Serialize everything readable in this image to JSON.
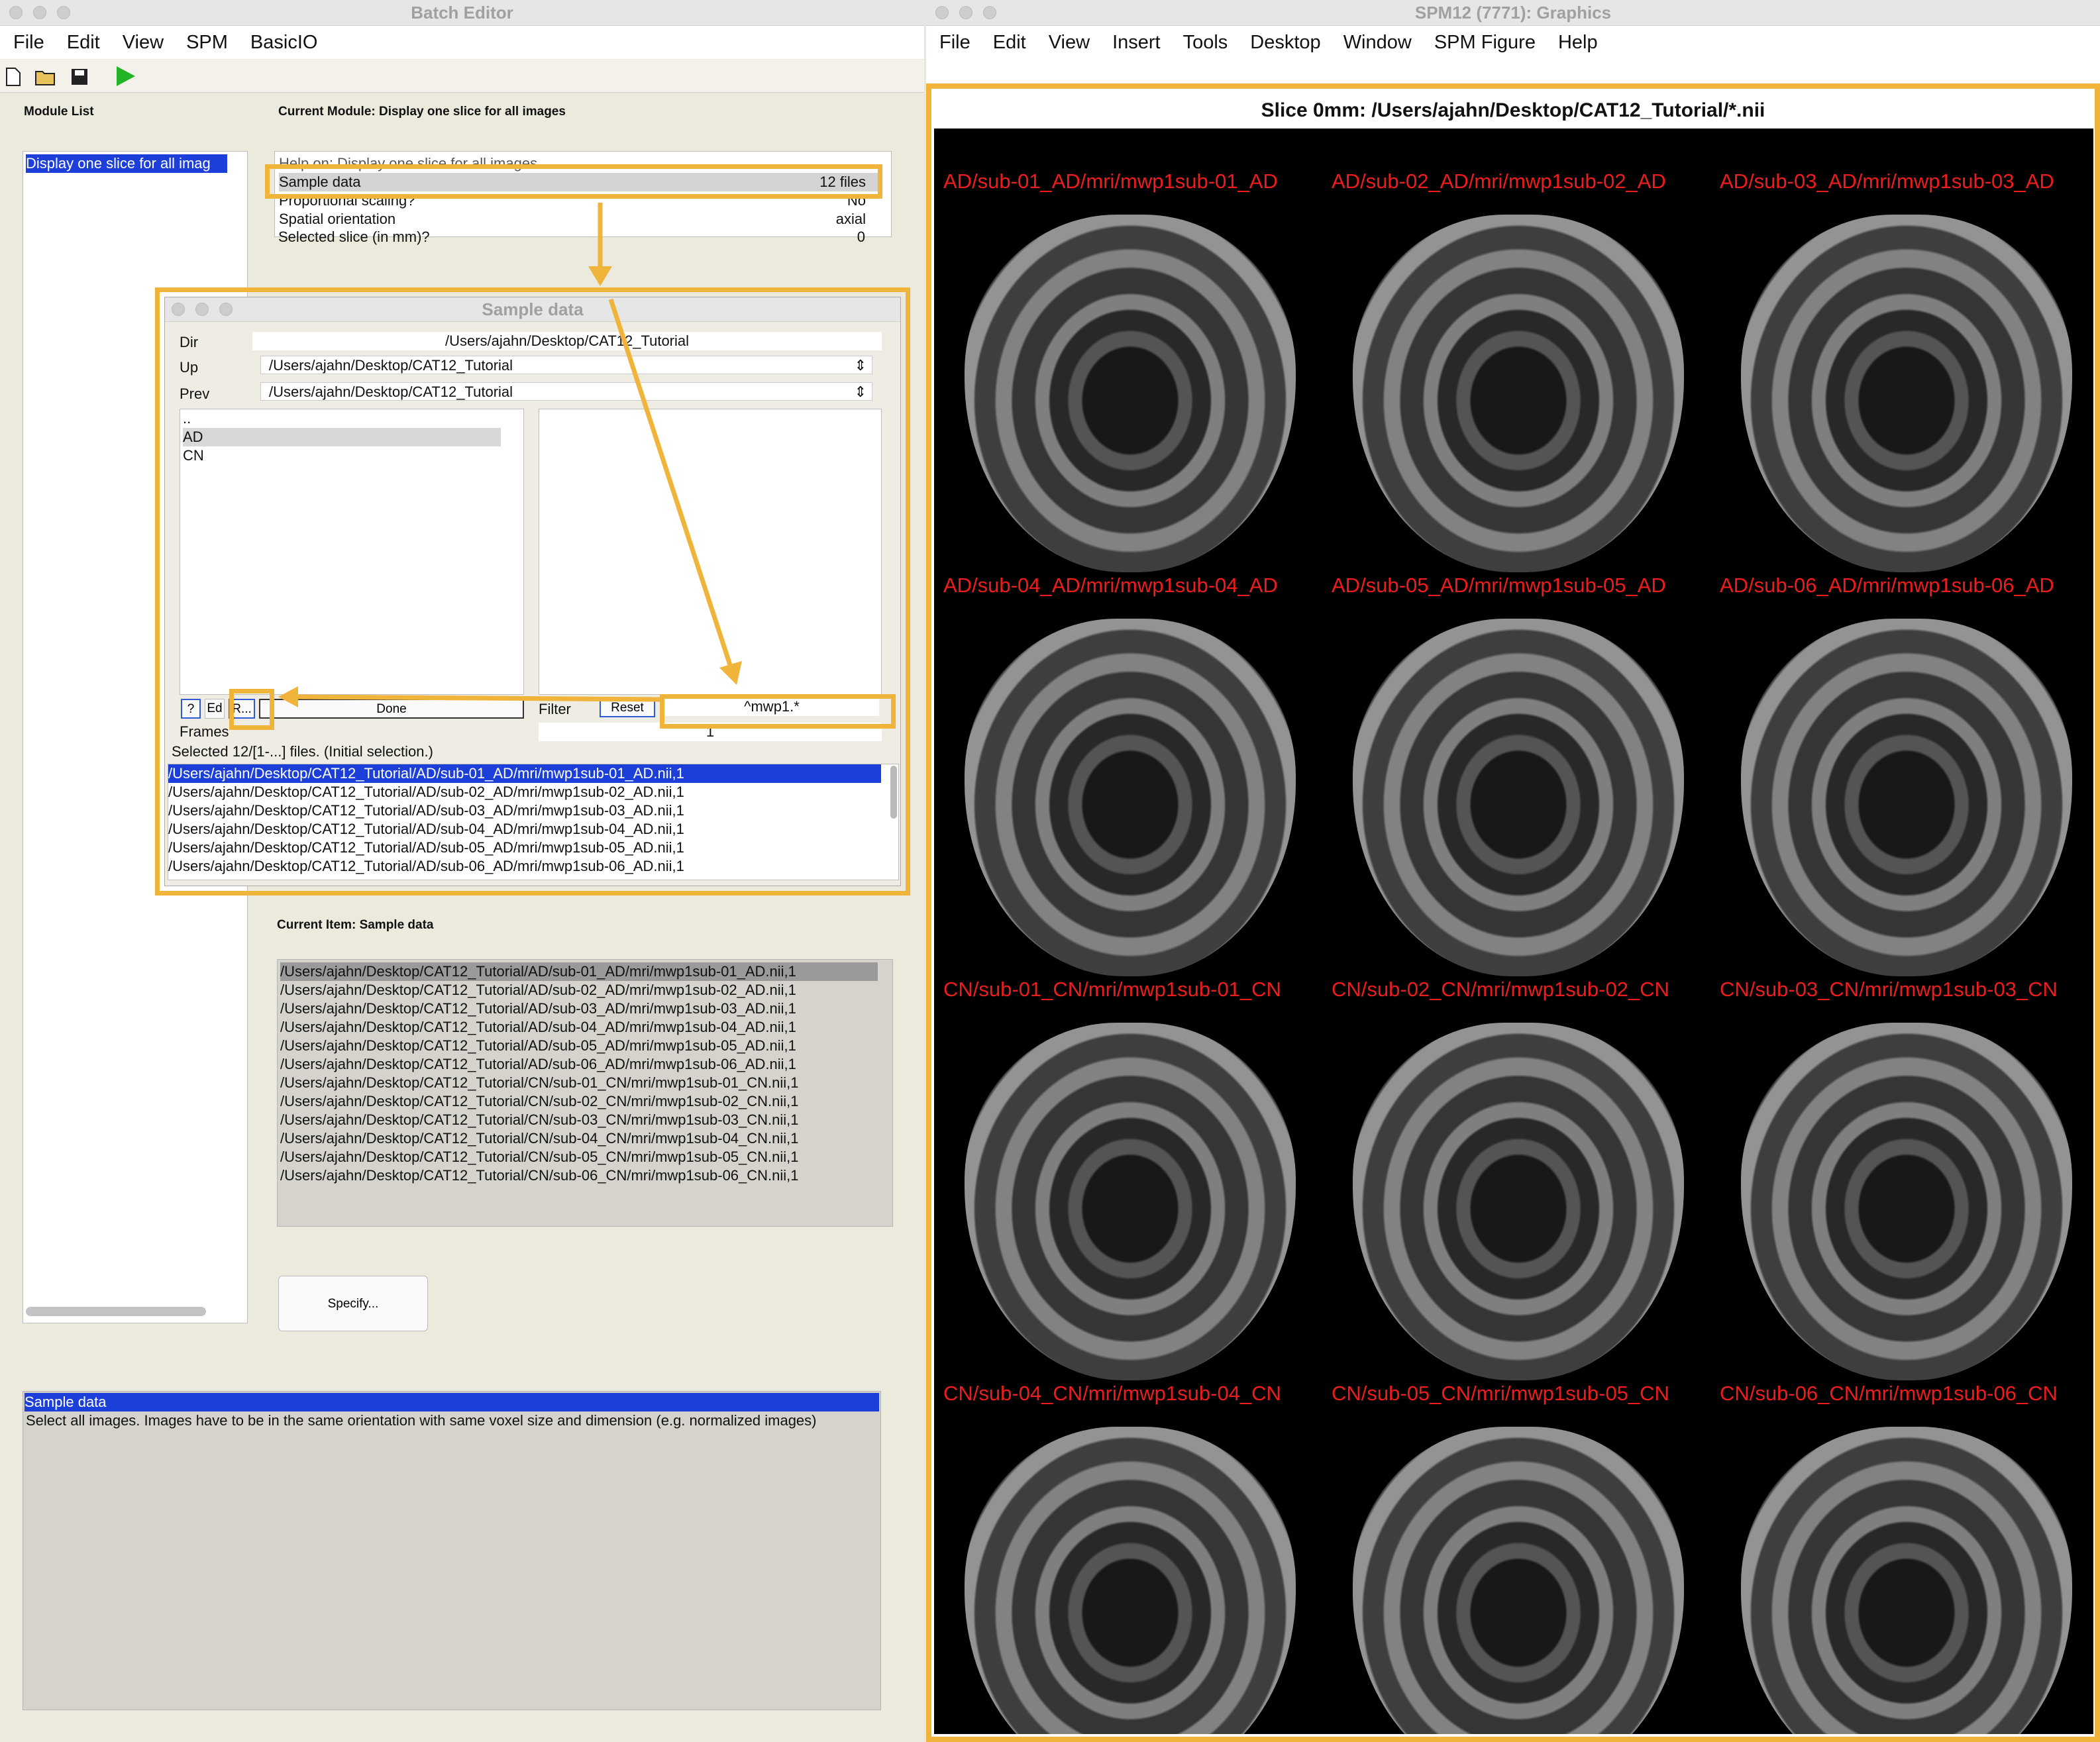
{
  "batch_editor": {
    "title": "Batch Editor",
    "menu": [
      "File",
      "Edit",
      "View",
      "SPM",
      "BasicIO"
    ],
    "module_list_label": "Module List",
    "current_module_label": "Current Module: Display one slice for all images",
    "module_list_items": [
      "Display one slice for all imag"
    ],
    "help_row": "Help on: Display one slice for all images",
    "module_rows": [
      {
        "name": "Sample data",
        "value": "12 files"
      },
      {
        "name": "Proportional scaling?",
        "value": "No"
      },
      {
        "name": "Spatial orientation",
        "value": "axial"
      },
      {
        "name": "Selected slice (in mm)?",
        "value": "0"
      }
    ],
    "current_item_label": "Current Item: Sample data",
    "current_item_files": [
      "/Users/ajahn/Desktop/CAT12_Tutorial/AD/sub-01_AD/mri/mwp1sub-01_AD.nii,1",
      "/Users/ajahn/Desktop/CAT12_Tutorial/AD/sub-02_AD/mri/mwp1sub-02_AD.nii,1",
      "/Users/ajahn/Desktop/CAT12_Tutorial/AD/sub-03_AD/mri/mwp1sub-03_AD.nii,1",
      "/Users/ajahn/Desktop/CAT12_Tutorial/AD/sub-04_AD/mri/mwp1sub-04_AD.nii,1",
      "/Users/ajahn/Desktop/CAT12_Tutorial/AD/sub-05_AD/mri/mwp1sub-05_AD.nii,1",
      "/Users/ajahn/Desktop/CAT12_Tutorial/AD/sub-06_AD/mri/mwp1sub-06_AD.nii,1",
      "/Users/ajahn/Desktop/CAT12_Tutorial/CN/sub-01_CN/mri/mwp1sub-01_CN.nii,1",
      "/Users/ajahn/Desktop/CAT12_Tutorial/CN/sub-02_CN/mri/mwp1sub-02_CN.nii,1",
      "/Users/ajahn/Desktop/CAT12_Tutorial/CN/sub-03_CN/mri/mwp1sub-03_CN.nii,1",
      "/Users/ajahn/Desktop/CAT12_Tutorial/CN/sub-04_CN/mri/mwp1sub-04_CN.nii,1",
      "/Users/ajahn/Desktop/CAT12_Tutorial/CN/sub-05_CN/mri/mwp1sub-05_CN.nii,1",
      "/Users/ajahn/Desktop/CAT12_Tutorial/CN/sub-06_CN/mri/mwp1sub-06_CN.nii,1"
    ],
    "specify_label": "Specify...",
    "help_title": "Sample data",
    "help_text": "Select all images. Images have to be in the same orientation with same voxel size and dimension (e.g. normalized images)"
  },
  "sample_dialog": {
    "title": "Sample data",
    "dir_label": "Dir",
    "dir_value": "/Users/ajahn/Desktop/CAT12_Tutorial",
    "up_label": "Up",
    "up_value": "/Users/ajahn/Desktop/CAT12_Tutorial",
    "prev_label": "Prev",
    "prev_value": "/Users/ajahn/Desktop/CAT12_Tutorial",
    "dirs": [
      "..",
      "AD",
      "CN"
    ],
    "btn_help": "?",
    "btn_ed": "Ed",
    "btn_r": "R...",
    "btn_done": "Done",
    "filter_label": "Filter",
    "btn_reset": "Reset",
    "filter_value": "^mwp1.*",
    "frames_label": "Frames",
    "frames_value": "1",
    "selected_text": "Selected 12/[1-...] files. (Initial selection.)",
    "selected_files": [
      "/Users/ajahn/Desktop/CAT12_Tutorial/AD/sub-01_AD/mri/mwp1sub-01_AD.nii,1",
      "/Users/ajahn/Desktop/CAT12_Tutorial/AD/sub-02_AD/mri/mwp1sub-02_AD.nii,1",
      "/Users/ajahn/Desktop/CAT12_Tutorial/AD/sub-03_AD/mri/mwp1sub-03_AD.nii,1",
      "/Users/ajahn/Desktop/CAT12_Tutorial/AD/sub-04_AD/mri/mwp1sub-04_AD.nii,1",
      "/Users/ajahn/Desktop/CAT12_Tutorial/AD/sub-05_AD/mri/mwp1sub-05_AD.nii,1",
      "/Users/ajahn/Desktop/CAT12_Tutorial/AD/sub-06_AD/mri/mwp1sub-06_AD.nii,1"
    ]
  },
  "graphics": {
    "title": "SPM12 (7771): Graphics",
    "menu": [
      "File",
      "Edit",
      "View",
      "Insert",
      "Tools",
      "Desktop",
      "Window",
      "SPM Figure",
      "Help"
    ],
    "figure_title": "Slice 0mm: /Users/ajahn/Desktop/CAT12_Tutorial/*.nii",
    "captions": [
      "AD/sub-01_AD/mri/mwp1sub-01_AD",
      "AD/sub-02_AD/mri/mwp1sub-02_AD",
      "AD/sub-03_AD/mri/mwp1sub-03_AD",
      "AD/sub-04_AD/mri/mwp1sub-04_AD",
      "AD/sub-05_AD/mri/mwp1sub-05_AD",
      "AD/sub-06_AD/mri/mwp1sub-06_AD",
      "CN/sub-01_CN/mri/mwp1sub-01_CN",
      "CN/sub-02_CN/mri/mwp1sub-02_CN",
      "CN/sub-03_CN/mri/mwp1sub-03_CN",
      "CN/sub-04_CN/mri/mwp1sub-04_CN",
      "CN/sub-05_CN/mri/mwp1sub-05_CN",
      "CN/sub-06_CN/mri/mwp1sub-06_CN"
    ]
  },
  "colors": {
    "highlight": "#f1b43b",
    "selection": "#1d3fd9",
    "caption": "#ee1c1c"
  }
}
